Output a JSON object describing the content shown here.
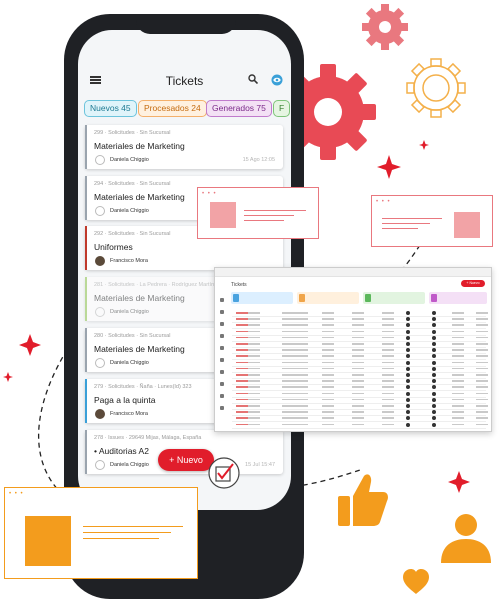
{
  "phone": {
    "title": "Tickets",
    "tabs": [
      {
        "label": "Nuevos 45"
      },
      {
        "label": "Procesados 24"
      },
      {
        "label": "Generados 75"
      },
      {
        "label": "F"
      }
    ],
    "tickets": [
      {
        "meta": "299 · Solicitudes · Sin Sucursal",
        "title": "Materiales de Marketing",
        "person": "Daniela Chiggio",
        "date": "15 Ago 12:05",
        "accent": "#9aa4ae"
      },
      {
        "meta": "294 · Solicitudes · Sin Sucursal",
        "title": "Materiales de Marketing",
        "person": "Daniela Chiggio",
        "date": "",
        "accent": "#9aa4ae"
      },
      {
        "meta": "292 · Solicitudes · Sin Sucursal",
        "title": "Uniformes",
        "person": "Francisco Mora",
        "date": "",
        "accent": "#c0392b"
      },
      {
        "meta": "281 · Solicitudes · La Pedrera · Rodríguez Martín",
        "title": "Materiales de Marketing",
        "person": "Daniela Chiggio",
        "date": "",
        "accent": "#8bc34a"
      },
      {
        "meta": "280 · Solicitudes · Sin Sucursal",
        "title": "Materiales de Marketing",
        "person": "Daniela Chiggio",
        "date": "",
        "accent": "#9aa4ae"
      },
      {
        "meta": "279 · Solicitudes · Ñaña · Lunes(Id) 323",
        "title": "Paga a la quinta",
        "person": "Francisco Mora",
        "date": "",
        "accent": "#3aa0d8"
      },
      {
        "meta": "278 · Issues · 29649 Mijas, Málaga, España",
        "title": "• Auditorias A2",
        "person": "Daniela Chiggio",
        "date": "15 Jul 15:47",
        "accent": "#9aa4ae"
      }
    ],
    "fab_label": "+ Nuevo"
  },
  "desktop": {
    "title": "Tickets",
    "new_button": "+ Nuevo",
    "columns": [
      {
        "color": "#4aa3df"
      },
      {
        "color": "#f0a54a"
      },
      {
        "color": "#5cb85c"
      },
      {
        "color": "#c05ac9"
      }
    ]
  },
  "colors": {
    "phone_body": "#1f2125",
    "accent_red": "#e11d2b",
    "gear_red": "#e84a55",
    "gear_pink": "#e9787f",
    "gear_outline": "#f4b04a",
    "orange": "#f39c1d"
  },
  "icons": [
    "menu-icon",
    "search-icon",
    "eye-icon",
    "gear-icon",
    "thumbs-up-icon",
    "person-icon",
    "heart-icon",
    "sparkle-icon",
    "checkbox-icon"
  ]
}
